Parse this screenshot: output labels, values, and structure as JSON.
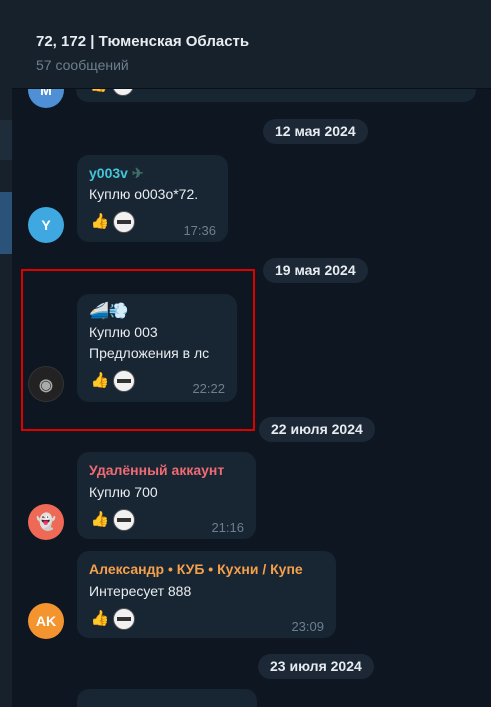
{
  "header": {
    "title": "72, 172 | Тюменская Область",
    "subtitle": "57 сообщений"
  },
  "avatars": [
    "M",
    "Y",
    "AK"
  ],
  "dates": [
    "12 мая 2024",
    "19 мая 2024",
    "22 июля 2024",
    "23 июля 2024"
  ],
  "messages": [
    {
      "author": "y003v",
      "text": "Куплю о003о*72.",
      "time": "17:36"
    },
    {
      "author": "",
      "text": "Куплю 003",
      "text2": "Предложения в лс",
      "time": "22:22",
      "emoji": "🚄💨"
    },
    {
      "author": "Удалённый аккаунт",
      "text": "Куплю 700",
      "time": "21:16"
    },
    {
      "author": "Александр • КУБ • Кухни / Купе",
      "text": "Интересует 888",
      "time": "23:09"
    }
  ],
  "colors": {
    "background": "#0e1621",
    "bubble": "#182533",
    "author_teal": "#45c5d8",
    "author_red": "#f06b73",
    "author_orange": "#f5a04a",
    "highlight": "#e00000"
  },
  "reaction_icons": [
    "thumbs-up-icon",
    "sticker-stamp-icon"
  ]
}
